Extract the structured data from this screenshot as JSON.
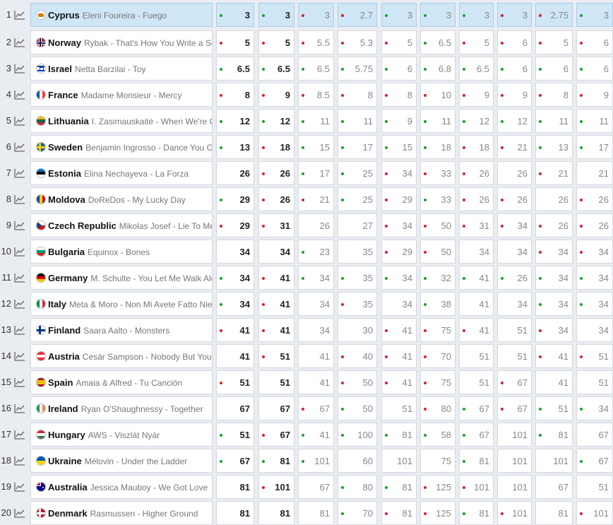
{
  "colors": {
    "up": "#13a32b",
    "down": "#d3202f",
    "highlight": "#cfe6f7"
  },
  "icons": {
    "trend": "line-chart-icon"
  },
  "rows": [
    {
      "rank": "1",
      "country": "Cyprus",
      "artist_song": "Eleni Foureira - Fuego",
      "flag": "cyprus",
      "odds": [
        {
          "v": "3",
          "t": "up"
        },
        {
          "v": "3",
          "t": "up"
        },
        {
          "v": "3",
          "t": "down"
        },
        {
          "v": "2.7",
          "t": "down"
        },
        {
          "v": "3",
          "t": "up"
        },
        {
          "v": "3",
          "t": "up"
        },
        {
          "v": "3",
          "t": "up"
        },
        {
          "v": "3",
          "t": "down"
        },
        {
          "v": "2.75",
          "t": "down"
        },
        {
          "v": "3",
          "t": "up"
        }
      ]
    },
    {
      "rank": "2",
      "country": "Norway",
      "artist_song": "Rybak - That's How You Write a Song",
      "flag": "norway",
      "odds": [
        {
          "v": "5",
          "t": "down"
        },
        {
          "v": "5",
          "t": "down"
        },
        {
          "v": "5.5",
          "t": "down"
        },
        {
          "v": "5.3",
          "t": "down"
        },
        {
          "v": "5",
          "t": "down"
        },
        {
          "v": "6.5",
          "t": "up"
        },
        {
          "v": "5",
          "t": "down"
        },
        {
          "v": "6",
          "t": "down"
        },
        {
          "v": "5",
          "t": "down"
        },
        {
          "v": "6",
          "t": "down"
        }
      ]
    },
    {
      "rank": "3",
      "country": "Israel",
      "artist_song": "Netta Barzilai - Toy",
      "flag": "israel",
      "odds": [
        {
          "v": "6.5",
          "t": "up"
        },
        {
          "v": "6.5",
          "t": "up"
        },
        {
          "v": "6.5",
          "t": "up"
        },
        {
          "v": "5.75",
          "t": "up"
        },
        {
          "v": "6",
          "t": "up"
        },
        {
          "v": "6.8",
          "t": "up"
        },
        {
          "v": "6.5",
          "t": "up"
        },
        {
          "v": "6",
          "t": "up"
        },
        {
          "v": "6",
          "t": "up"
        },
        {
          "v": "6",
          "t": "up"
        }
      ]
    },
    {
      "rank": "4",
      "country": "France",
      "artist_song": "Madame Monsieur - Mercy",
      "flag": "france",
      "odds": [
        {
          "v": "8",
          "t": "down"
        },
        {
          "v": "9",
          "t": "down"
        },
        {
          "v": "8.5",
          "t": "down"
        },
        {
          "v": "8",
          "t": "down"
        },
        {
          "v": "8",
          "t": "down"
        },
        {
          "v": "10",
          "t": "down"
        },
        {
          "v": "9",
          "t": "down"
        },
        {
          "v": "9",
          "t": "down"
        },
        {
          "v": "8",
          "t": "down"
        },
        {
          "v": "9",
          "t": "down"
        }
      ]
    },
    {
      "rank": "5",
      "country": "Lithuania",
      "artist_song": "I. Zasimauskaitė - When We're Old",
      "flag": "lithuania",
      "odds": [
        {
          "v": "12",
          "t": "up"
        },
        {
          "v": "12",
          "t": "up"
        },
        {
          "v": "11",
          "t": "up"
        },
        {
          "v": "11",
          "t": "up"
        },
        {
          "v": "9",
          "t": "up"
        },
        {
          "v": "11",
          "t": "up"
        },
        {
          "v": "12",
          "t": "up"
        },
        {
          "v": "12",
          "t": "up"
        },
        {
          "v": "11",
          "t": "up"
        },
        {
          "v": "11",
          "t": "up"
        }
      ]
    },
    {
      "rank": "6",
      "country": "Sweden",
      "artist_song": "Benjamin Ingrosso - Dance You Off",
      "flag": "sweden",
      "odds": [
        {
          "v": "13",
          "t": "up"
        },
        {
          "v": "18",
          "t": "down"
        },
        {
          "v": "15",
          "t": "up"
        },
        {
          "v": "17",
          "t": "up"
        },
        {
          "v": "15",
          "t": "up"
        },
        {
          "v": "18",
          "t": "up"
        },
        {
          "v": "18",
          "t": "down"
        },
        {
          "v": "21",
          "t": "down"
        },
        {
          "v": "13",
          "t": "up"
        },
        {
          "v": "17",
          "t": "up"
        }
      ]
    },
    {
      "rank": "7",
      "country": "Estonia",
      "artist_song": "Elina Nechayeva - La Forza",
      "flag": "estonia",
      "odds": [
        {
          "v": "26",
          "t": ""
        },
        {
          "v": "26",
          "t": "down"
        },
        {
          "v": "17",
          "t": "up"
        },
        {
          "v": "25",
          "t": "up"
        },
        {
          "v": "34",
          "t": "down"
        },
        {
          "v": "33",
          "t": "down"
        },
        {
          "v": "26",
          "t": "down"
        },
        {
          "v": "26",
          "t": ""
        },
        {
          "v": "21",
          "t": "down"
        },
        {
          "v": "21",
          "t": ""
        }
      ]
    },
    {
      "rank": "8",
      "country": "Moldova",
      "artist_song": "DoReDos - My Lucky Day",
      "flag": "moldova",
      "odds": [
        {
          "v": "29",
          "t": "up"
        },
        {
          "v": "26",
          "t": "down"
        },
        {
          "v": "21",
          "t": "down"
        },
        {
          "v": "25",
          "t": "up"
        },
        {
          "v": "29",
          "t": "down"
        },
        {
          "v": "33",
          "t": "up"
        },
        {
          "v": "26",
          "t": "down"
        },
        {
          "v": "26",
          "t": "down"
        },
        {
          "v": "26",
          "t": ""
        },
        {
          "v": "26",
          "t": "down"
        }
      ]
    },
    {
      "rank": "9",
      "country": "Czech Republic",
      "artist_song": "Mikolas Josef - Lie To Me",
      "flag": "czech",
      "odds": [
        {
          "v": "29",
          "t": "down"
        },
        {
          "v": "31",
          "t": "down"
        },
        {
          "v": "26",
          "t": ""
        },
        {
          "v": "27",
          "t": ""
        },
        {
          "v": "34",
          "t": "down"
        },
        {
          "v": "50",
          "t": "down"
        },
        {
          "v": "31",
          "t": "down"
        },
        {
          "v": "34",
          "t": "down"
        },
        {
          "v": "26",
          "t": "down"
        },
        {
          "v": "26",
          "t": "down"
        }
      ]
    },
    {
      "rank": "10",
      "country": "Bulgaria",
      "artist_song": "Equinox - Bones",
      "flag": "bulgaria",
      "odds": [
        {
          "v": "34",
          "t": ""
        },
        {
          "v": "34",
          "t": ""
        },
        {
          "v": "23",
          "t": "up"
        },
        {
          "v": "35",
          "t": ""
        },
        {
          "v": "29",
          "t": "down"
        },
        {
          "v": "50",
          "t": "down"
        },
        {
          "v": "34",
          "t": ""
        },
        {
          "v": "34",
          "t": ""
        },
        {
          "v": "34",
          "t": "down"
        },
        {
          "v": "34",
          "t": "down"
        }
      ]
    },
    {
      "rank": "11",
      "country": "Germany",
      "artist_song": "M. Schulte - You Let Me Walk Alone",
      "flag": "germany",
      "odds": [
        {
          "v": "34",
          "t": "up"
        },
        {
          "v": "41",
          "t": "down"
        },
        {
          "v": "34",
          "t": "up"
        },
        {
          "v": "35",
          "t": "up"
        },
        {
          "v": "34",
          "t": "up"
        },
        {
          "v": "32",
          "t": "up"
        },
        {
          "v": "41",
          "t": "up"
        },
        {
          "v": "26",
          "t": "up"
        },
        {
          "v": "34",
          "t": "up"
        },
        {
          "v": "34",
          "t": "up"
        }
      ]
    },
    {
      "rank": "12",
      "country": "Italy",
      "artist_song": "Meta & Moro - Non Mi Avete Fatto Niente",
      "flag": "italy",
      "odds": [
        {
          "v": "34",
          "t": "up"
        },
        {
          "v": "41",
          "t": "down"
        },
        {
          "v": "34",
          "t": ""
        },
        {
          "v": "35",
          "t": "down"
        },
        {
          "v": "34",
          "t": ""
        },
        {
          "v": "38",
          "t": "up"
        },
        {
          "v": "41",
          "t": ""
        },
        {
          "v": "34",
          "t": ""
        },
        {
          "v": "34",
          "t": "up"
        },
        {
          "v": "34",
          "t": "up"
        }
      ]
    },
    {
      "rank": "13",
      "country": "Finland",
      "artist_song": "Saara Aalto - Monsters",
      "flag": "finland",
      "odds": [
        {
          "v": "41",
          "t": "down"
        },
        {
          "v": "41",
          "t": "down"
        },
        {
          "v": "34",
          "t": ""
        },
        {
          "v": "30",
          "t": ""
        },
        {
          "v": "41",
          "t": "down"
        },
        {
          "v": "75",
          "t": "down"
        },
        {
          "v": "41",
          "t": "down"
        },
        {
          "v": "51",
          "t": ""
        },
        {
          "v": "34",
          "t": "down"
        },
        {
          "v": "34",
          "t": ""
        }
      ]
    },
    {
      "rank": "14",
      "country": "Austria",
      "artist_song": "Cesár Sampson - Nobody But You",
      "flag": "austria",
      "odds": [
        {
          "v": "41",
          "t": ""
        },
        {
          "v": "51",
          "t": "down"
        },
        {
          "v": "41",
          "t": ""
        },
        {
          "v": "40",
          "t": "down"
        },
        {
          "v": "41",
          "t": "down"
        },
        {
          "v": "70",
          "t": "down"
        },
        {
          "v": "51",
          "t": ""
        },
        {
          "v": "51",
          "t": ""
        },
        {
          "v": "41",
          "t": "down"
        },
        {
          "v": "51",
          "t": "down"
        }
      ]
    },
    {
      "rank": "15",
      "country": "Spain",
      "artist_song": "Amaia & Alfred - Tu Canción",
      "flag": "spain",
      "odds": [
        {
          "v": "51",
          "t": "down"
        },
        {
          "v": "51",
          "t": ""
        },
        {
          "v": "41",
          "t": ""
        },
        {
          "v": "50",
          "t": "down"
        },
        {
          "v": "41",
          "t": "down"
        },
        {
          "v": "75",
          "t": "down"
        },
        {
          "v": "51",
          "t": ""
        },
        {
          "v": "67",
          "t": "down"
        },
        {
          "v": "41",
          "t": ""
        },
        {
          "v": "51",
          "t": ""
        }
      ]
    },
    {
      "rank": "16",
      "country": "Ireland",
      "artist_song": "Ryan O'Shaughnessy - Together",
      "flag": "ireland",
      "odds": [
        {
          "v": "67",
          "t": ""
        },
        {
          "v": "67",
          "t": ""
        },
        {
          "v": "67",
          "t": "down"
        },
        {
          "v": "50",
          "t": "up"
        },
        {
          "v": "51",
          "t": ""
        },
        {
          "v": "80",
          "t": "down"
        },
        {
          "v": "67",
          "t": "up"
        },
        {
          "v": "67",
          "t": "down"
        },
        {
          "v": "51",
          "t": "up"
        },
        {
          "v": "34",
          "t": "up"
        }
      ]
    },
    {
      "rank": "17",
      "country": "Hungary",
      "artist_song": "AWS - Viszlát Nyár",
      "flag": "hungary",
      "odds": [
        {
          "v": "51",
          "t": "up"
        },
        {
          "v": "67",
          "t": "down"
        },
        {
          "v": "41",
          "t": "up"
        },
        {
          "v": "100",
          "t": "up"
        },
        {
          "v": "81",
          "t": "up"
        },
        {
          "v": "58",
          "t": "up"
        },
        {
          "v": "67",
          "t": "up"
        },
        {
          "v": "101",
          "t": ""
        },
        {
          "v": "81",
          "t": "up"
        },
        {
          "v": "67",
          "t": ""
        }
      ]
    },
    {
      "rank": "18",
      "country": "Ukraine",
      "artist_song": "Mélovin - Under the Ladder",
      "flag": "ukraine",
      "odds": [
        {
          "v": "67",
          "t": "up"
        },
        {
          "v": "81",
          "t": "up"
        },
        {
          "v": "101",
          "t": "up"
        },
        {
          "v": "60",
          "t": ""
        },
        {
          "v": "101",
          "t": ""
        },
        {
          "v": "75",
          "t": ""
        },
        {
          "v": "81",
          "t": "up"
        },
        {
          "v": "101",
          "t": ""
        },
        {
          "v": "101",
          "t": ""
        },
        {
          "v": "67",
          "t": "up"
        }
      ]
    },
    {
      "rank": "19",
      "country": "Australia",
      "artist_song": "Jessica Mauboy - We Got Love",
      "flag": "australia",
      "odds": [
        {
          "v": "81",
          "t": ""
        },
        {
          "v": "101",
          "t": "down"
        },
        {
          "v": "67",
          "t": ""
        },
        {
          "v": "80",
          "t": "up"
        },
        {
          "v": "81",
          "t": "up"
        },
        {
          "v": "125",
          "t": "down"
        },
        {
          "v": "101",
          "t": "down"
        },
        {
          "v": "101",
          "t": ""
        },
        {
          "v": "67",
          "t": ""
        },
        {
          "v": "51",
          "t": ""
        }
      ]
    },
    {
      "rank": "20",
      "country": "Denmark",
      "artist_song": "Rasmussen - Higher Ground",
      "flag": "denmark",
      "odds": [
        {
          "v": "81",
          "t": ""
        },
        {
          "v": "81",
          "t": ""
        },
        {
          "v": "81",
          "t": ""
        },
        {
          "v": "70",
          "t": "up"
        },
        {
          "v": "81",
          "t": "down"
        },
        {
          "v": "125",
          "t": "down"
        },
        {
          "v": "81",
          "t": "up"
        },
        {
          "v": "101",
          "t": "down"
        },
        {
          "v": "81",
          "t": ""
        },
        {
          "v": "101",
          "t": "down"
        }
      ]
    }
  ]
}
